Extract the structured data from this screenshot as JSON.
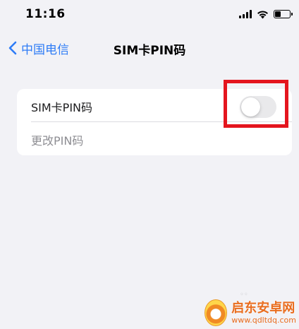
{
  "status_bar": {
    "time": "11:16",
    "icons": [
      "cellular-signal-icon",
      "wifi-icon",
      "battery-icon"
    ],
    "battery_level": 0.4
  },
  "nav": {
    "back_label": "中国电信",
    "title": "SIM卡PIN码"
  },
  "settings": {
    "rows": [
      {
        "label": "SIM卡PIN码",
        "toggle_on": false
      },
      {
        "label": "更改PIN码",
        "enabled": false
      }
    ]
  },
  "watermark": {
    "name": "启东安卓网",
    "url": "www.qdltdq.com"
  },
  "colors": {
    "accent": "#2e7cf6",
    "background": "#f2f2f6",
    "highlight": "#e4151e",
    "toggle_off": "#e9e9eb",
    "disabled_text": "#8e8e93"
  }
}
